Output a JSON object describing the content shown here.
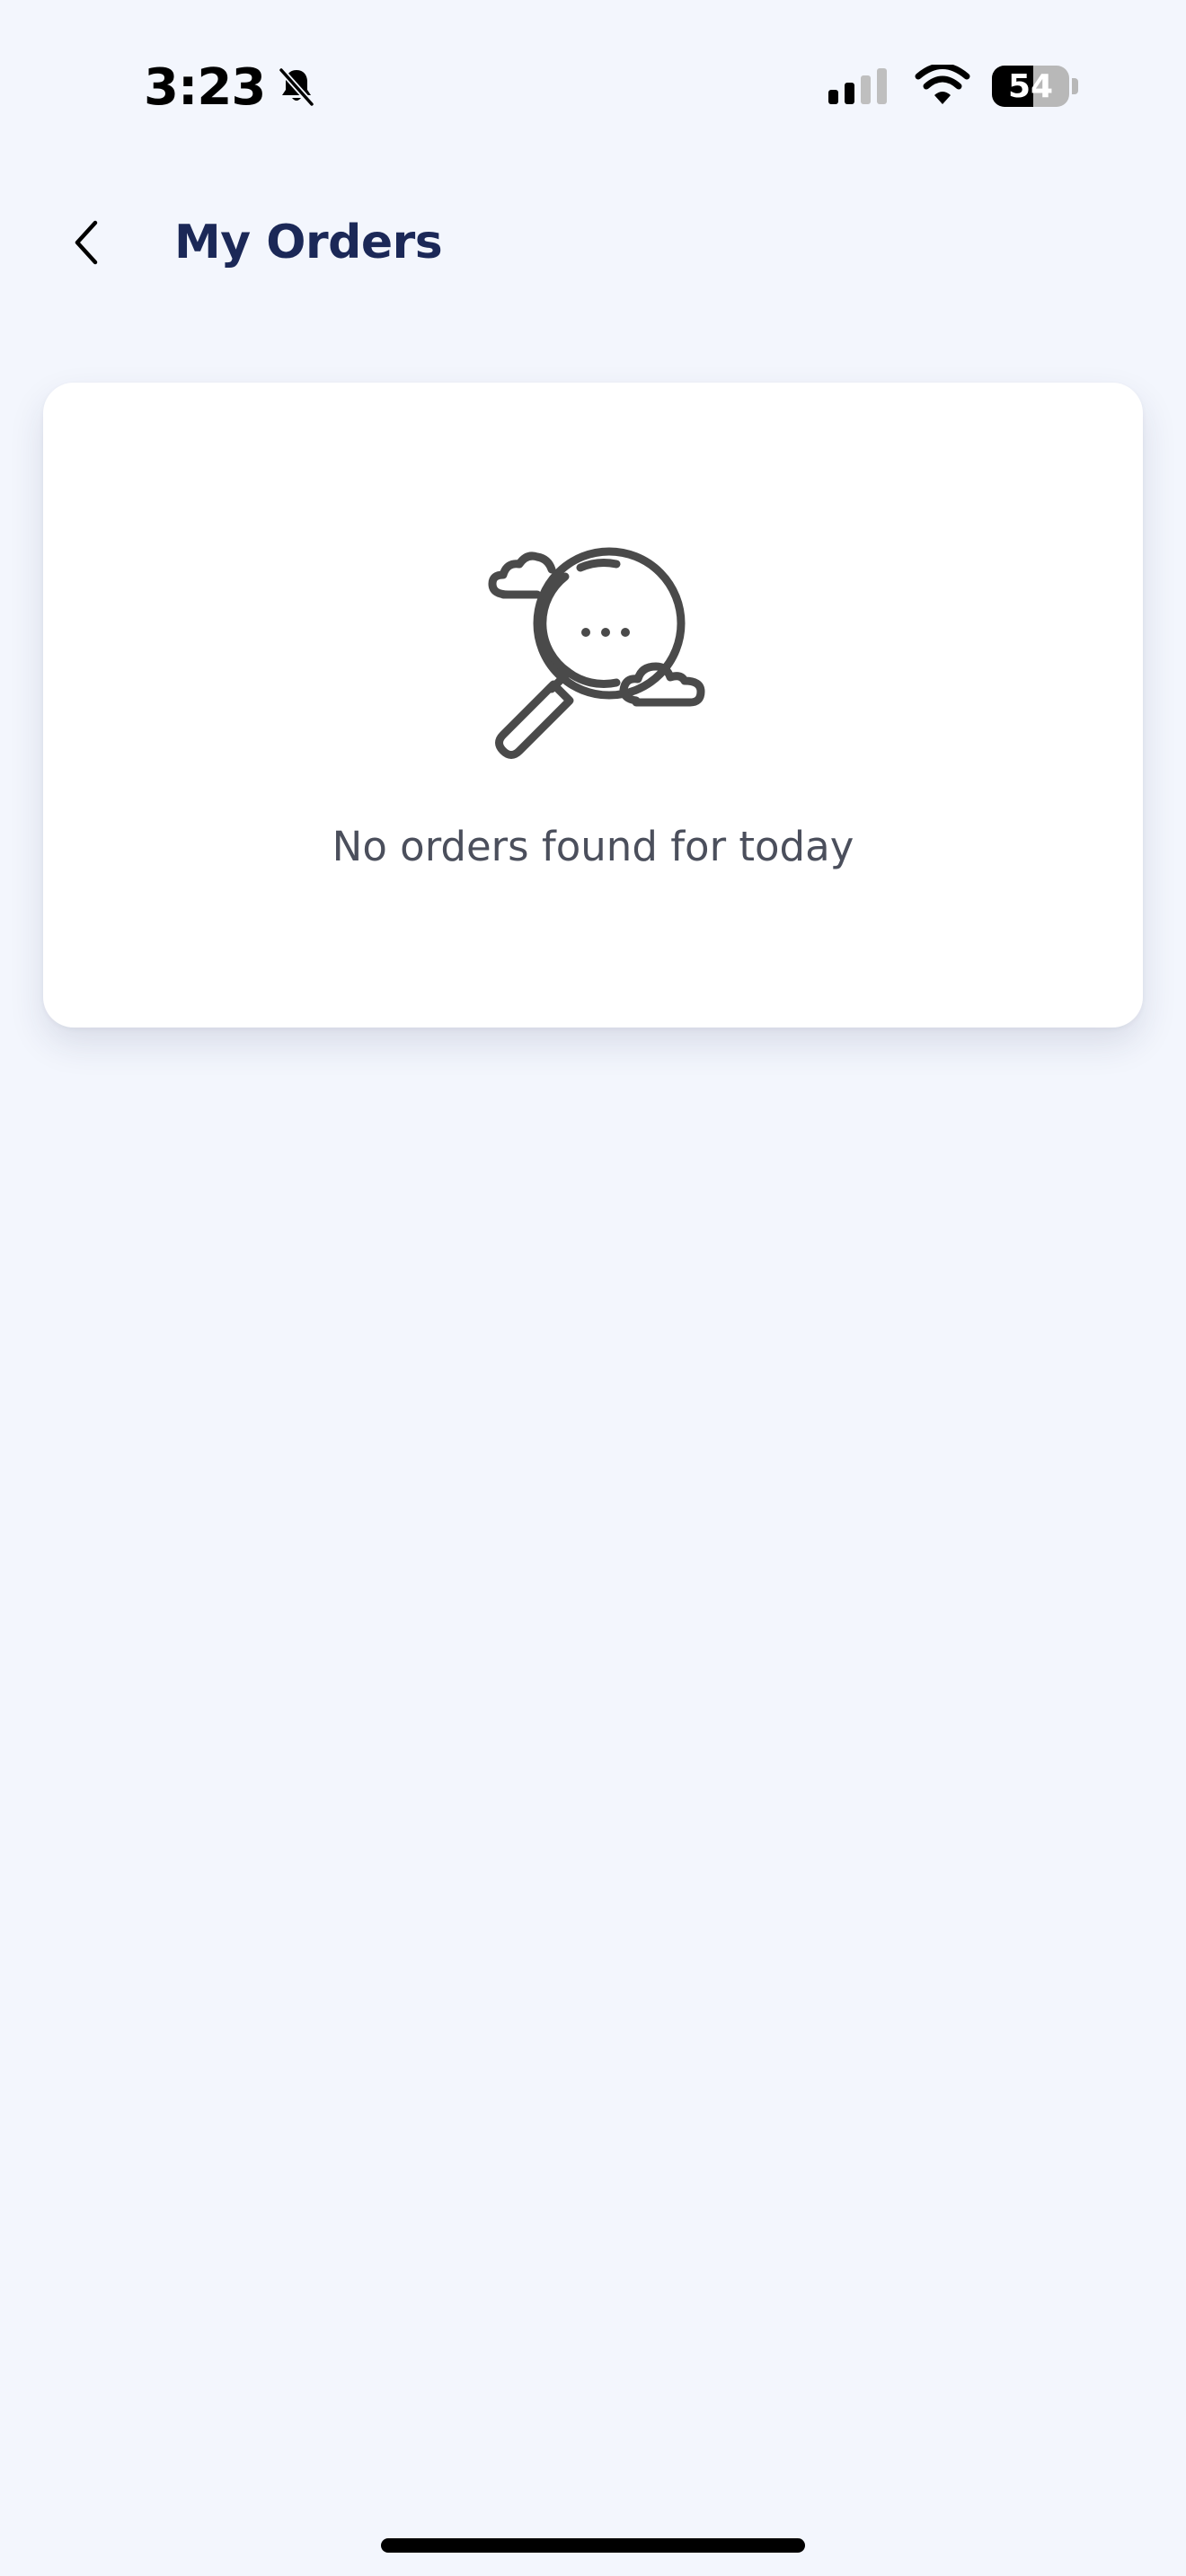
{
  "status_bar": {
    "time": "3:23",
    "battery_level": "54",
    "battery_fraction": 0.54,
    "icons": [
      "bell-slash-icon",
      "cellular-signal-icon",
      "wifi-icon",
      "battery-icon"
    ]
  },
  "header": {
    "back_icon": "chevron-left-icon",
    "title": "My Orders"
  },
  "empty_state": {
    "icon": "magnifier-with-clouds-icon",
    "message": "No orders found for today"
  },
  "colors": {
    "background": "#f3f6fd",
    "title": "#1b2857",
    "message": "#4b4f5c",
    "icon_stroke": "#4a4a4a",
    "card": "#ffffff"
  }
}
